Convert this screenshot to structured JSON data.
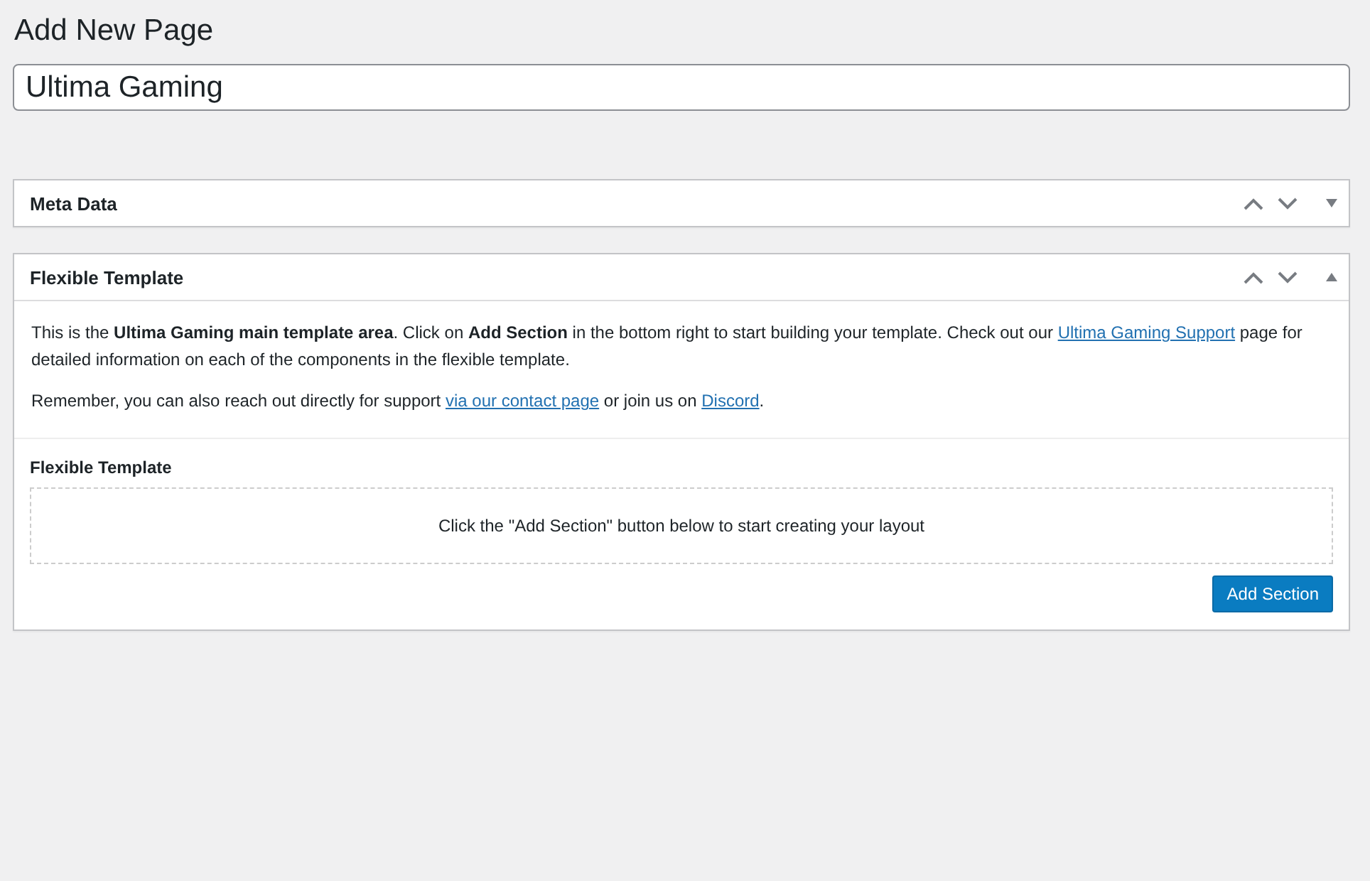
{
  "page_title": "Add New Page",
  "title_field": {
    "value": "Ultima Gaming"
  },
  "panels": [
    {
      "title": "Meta Data",
      "expanded": false
    },
    {
      "title": "Flexible Template",
      "expanded": true,
      "paragraphs": [
        [
          {
            "kind": "text",
            "text": "This is the **Ultima Gaming main template area**. Click on **Add Section** in the bottom right to start building your template. Check out our "
          },
          {
            "kind": "link",
            "text": "Ultima Gaming Support"
          },
          {
            "kind": "text",
            "text": " page for detailed information on each of the components in the flexible template."
          }
        ],
        [
          {
            "kind": "text",
            "text": "Remember, you can also reach out directly for support "
          },
          {
            "kind": "link",
            "text": "via our contact page"
          },
          {
            "kind": "text",
            "text": " or join us on "
          },
          {
            "kind": "link",
            "text": "Discord"
          },
          {
            "kind": "text",
            "text": "."
          }
        ]
      ],
      "field_label": "Flexible Template",
      "empty_message": "Click the \"Add Section\" button below to start creating your layout",
      "button": "Add Section"
    }
  ]
}
